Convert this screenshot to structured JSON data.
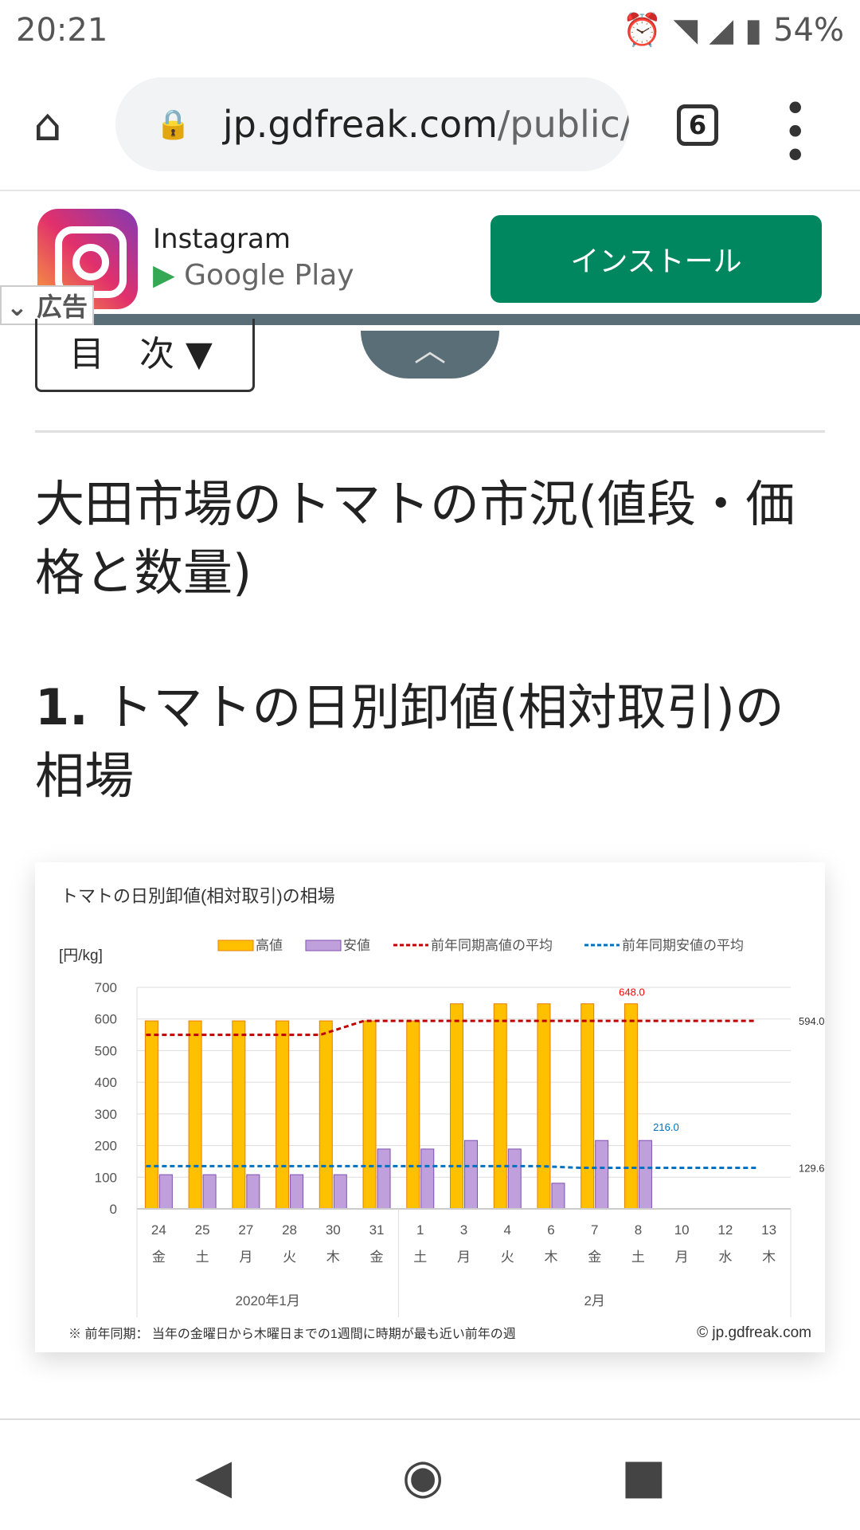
{
  "status": {
    "time": "20:21",
    "battery": "54%"
  },
  "browser": {
    "url_host": "jp.gdfreak.com",
    "url_path": "/public/",
    "tab_count": "6"
  },
  "ad": {
    "app_name": "Instagram",
    "store": "Google Play",
    "install_label": "インストール",
    "ad_tag": "広告"
  },
  "toc_label": "目　次",
  "page_title": "大田市場のトマトの市況(値段・価格と数量)",
  "section": {
    "number": "1.",
    "title": "トマトの日別卸値(相対取引)の相場"
  },
  "chart_data": {
    "type": "bar",
    "title": "トマトの日別卸値(相対取引)の相場",
    "ylabel": "[円/kg]",
    "ylim": [
      0,
      700
    ],
    "yticks": [
      0,
      100,
      200,
      300,
      400,
      500,
      600,
      700
    ],
    "grid": true,
    "legend_position": "top",
    "categories": [
      "24",
      "25",
      "27",
      "28",
      "30",
      "31",
      "1",
      "3",
      "4",
      "6",
      "7",
      "8",
      "10",
      "12",
      "13"
    ],
    "weekdays": [
      "金",
      "土",
      "月",
      "火",
      "木",
      "金",
      "土",
      "月",
      "火",
      "木",
      "金",
      "土",
      "月",
      "水",
      "木"
    ],
    "month_groups": [
      {
        "label": "2020年1月",
        "count": 6
      },
      {
        "label": "2月",
        "count": 9
      }
    ],
    "series": [
      {
        "name": "高値",
        "type": "bar",
        "color": "#ffc000",
        "values": [
          594,
          594,
          594,
          594,
          594,
          594,
          594,
          648,
          648,
          648,
          648,
          648,
          null,
          null,
          null
        ]
      },
      {
        "name": "安値",
        "type": "bar",
        "color": "#c0a0dc",
        "values": [
          108,
          108,
          108,
          108,
          108,
          189,
          189,
          216,
          189,
          81,
          216,
          216,
          null,
          null,
          null
        ]
      },
      {
        "name": "前年同期高値の平均",
        "type": "line",
        "color": "#c00000",
        "values": [
          550,
          550,
          550,
          550,
          550,
          594,
          594,
          594,
          594,
          594,
          594,
          594,
          594,
          594,
          594
        ]
      },
      {
        "name": "前年同期安値の平均",
        "type": "line",
        "color": "#0070c0",
        "values": [
          135,
          135,
          135,
          135,
          135,
          135,
          135,
          135,
          135,
          135,
          129.6,
          129.6,
          129.6,
          129.6,
          129.6
        ]
      }
    ],
    "annotations": [
      {
        "text": "648.0",
        "color": "#ff0000"
      },
      {
        "text": "216.0",
        "color": "#0070c0"
      },
      {
        "text": "594.0",
        "color": "#333333"
      },
      {
        "text": "129.6",
        "color": "#333333"
      }
    ],
    "footnote": "※ 前年同期： 当年の金曜日から木曜日までの1週間に時期が最も近い前年の週",
    "copyright": "© jp.gdfreak.com"
  }
}
